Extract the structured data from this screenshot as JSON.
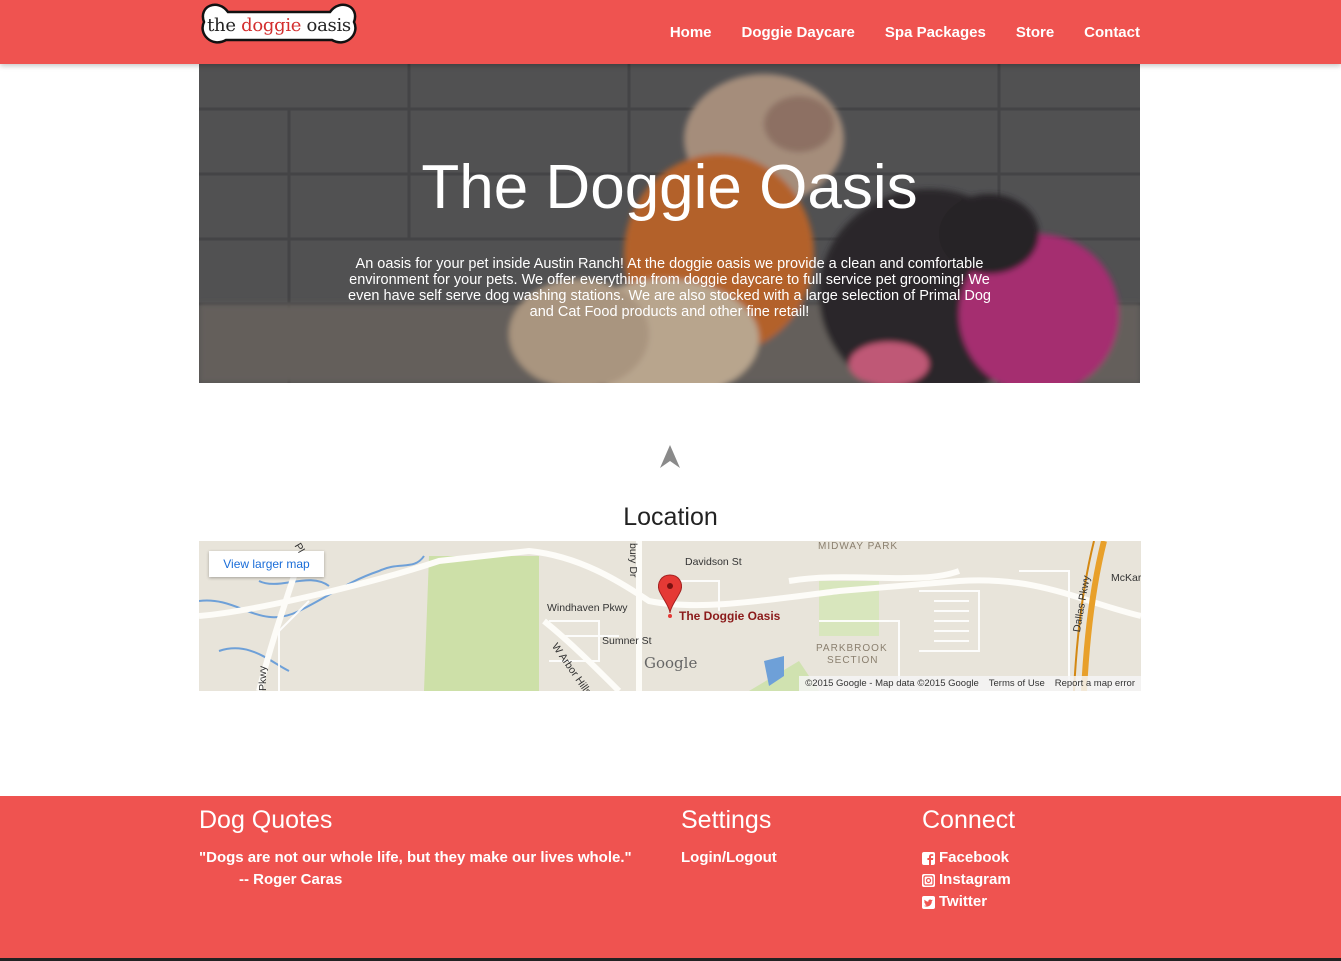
{
  "nav": {
    "logo": {
      "prefix": "the ",
      "accent": "doggie",
      "suffix": " oasis"
    },
    "links": [
      "Home",
      "Doggie Daycare",
      "Spa Packages",
      "Store",
      "Contact"
    ]
  },
  "hero": {
    "title": "The Doggie Oasis",
    "description": "An oasis for your pet inside Austin Ranch! At the doggie oasis we provide a clean and comfortable environment for your pets. We offer everything from doggie daycare to full service pet grooming! We even have self serve dog washing stations. We are also stocked with a large selection of Primal Dog and Cat Food products and other fine retail!"
  },
  "location": {
    "title": "Location",
    "map": {
      "view_larger": "View larger map",
      "pin_label": "The Doggie Oasis",
      "streets": [
        "Davidson St",
        "Windhaven Pkwy",
        "Sumner St",
        "W Arbor Hills Way",
        "Dallas Pkwy",
        "bury Dr",
        "Pkwy",
        "McKar",
        "Pl"
      ],
      "areas": [
        "MIDWAY PARK",
        "PARKBROOK",
        "SECTION"
      ],
      "google_mark": "Google",
      "footer": [
        "©2015 Google - Map data ©2015 Google",
        "Terms of Use",
        "Report a map error"
      ]
    }
  },
  "footer": {
    "quotes": {
      "title": "Dog Quotes",
      "quote": "\"Dogs are not our whole life, but they make our lives whole.\"",
      "author": "-- Roger Caras"
    },
    "settings": {
      "title": "Settings",
      "link": "Login/Logout"
    },
    "connect": {
      "title": "Connect",
      "links": [
        "Facebook",
        "Instagram",
        "Twitter"
      ]
    }
  },
  "colors": {
    "brand_red": "#ef5350",
    "text_dark": "#222222",
    "map_link": "#1a6dd8"
  },
  "icons": [
    "bone-logo",
    "up-arrow-icon",
    "map-pin-icon",
    "facebook-icon",
    "instagram-icon",
    "twitter-icon"
  ]
}
